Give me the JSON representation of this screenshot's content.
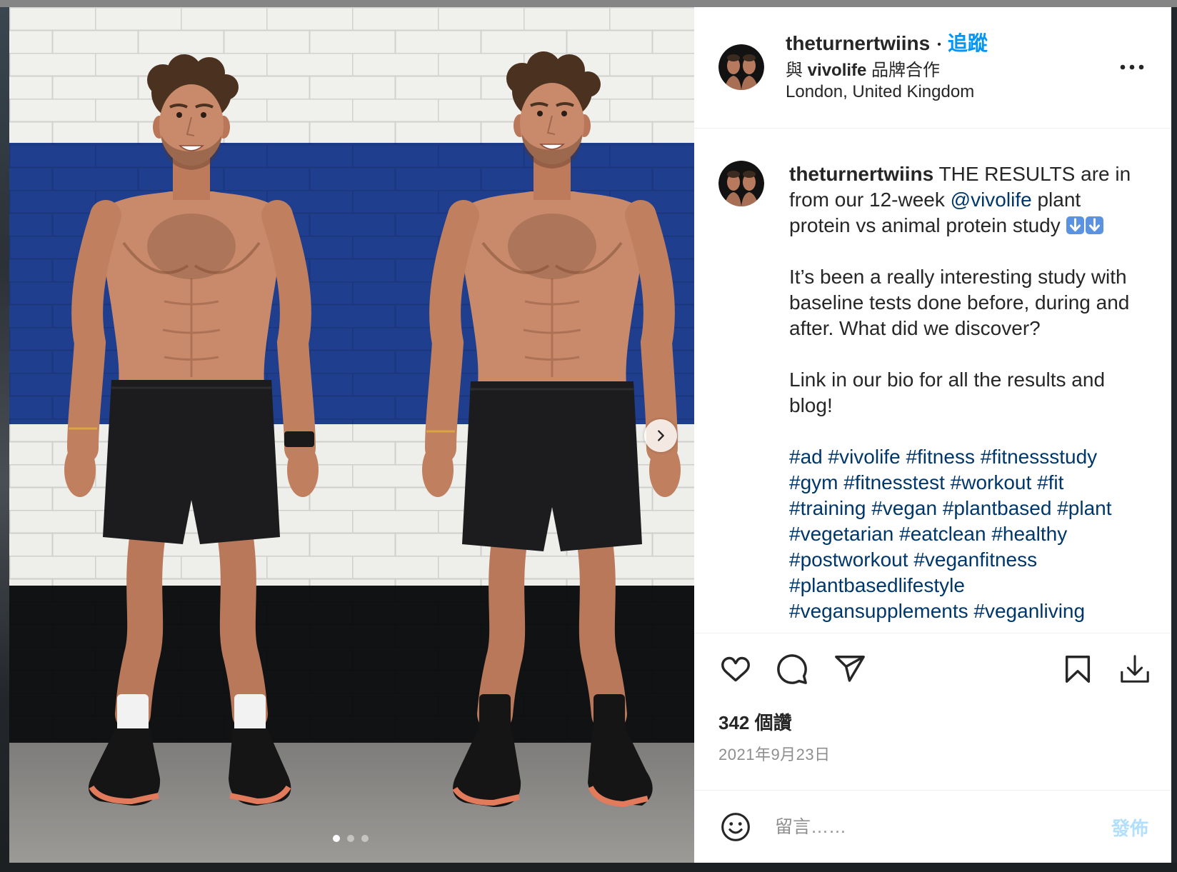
{
  "colors": {
    "text": "#262626",
    "link": "#00376b",
    "follow": "#0095f6",
    "secondary": "#8e8e8e",
    "post_disabled": "#b2dffc",
    "divider": "#efefef"
  },
  "post": {
    "header": {
      "avatar_icon": "profile-avatar",
      "username": "theturnertwiins",
      "separator": "•",
      "follow_label": "追蹤",
      "partnership_prefix": "與",
      "partnership_brand": "vivolife",
      "partnership_suffix": "品牌合作",
      "location": "London, United Kingdom",
      "more_icon": "more-options-icon"
    },
    "media": {
      "total": 3,
      "current_index": 1,
      "next_icon": "chevron-right-icon"
    },
    "caption": {
      "avatar_icon": "profile-avatar",
      "username": "theturnertwiins",
      "line1": "THE RESULTS are in",
      "line2_before": "from our 12-week",
      "mention": "@vivolife",
      "line2_after": "plant",
      "line3": "protein vs animal protein study",
      "line3_emoji": [
        "down-arrow-emoji-icon",
        "down-arrow-emoji-icon"
      ],
      "paragraph2": [
        "It’s been a really interesting study with",
        "baseline tests done before, during and",
        "after. What did we discover?"
      ],
      "paragraph3": [
        "Link in our bio for all the results and",
        "blog!"
      ],
      "hashtags": [
        [
          "#ad",
          "#vivolife",
          "#fitness",
          "#fitnessstudy"
        ],
        [
          "#gym",
          "#fitnesstest",
          "#workout",
          "#fit"
        ],
        [
          "#training",
          "#vegan",
          "#plantbased",
          "#plant"
        ],
        [
          "#vegetarian",
          "#eatclean",
          "#healthy"
        ],
        [
          "#postworkout",
          "#veganfitness"
        ],
        [
          "#plantbasedlifestyle"
        ],
        [
          "#vegansupplements",
          "#veganliving"
        ]
      ]
    },
    "actions": {
      "like_icon": "heart-icon",
      "comment_icon": "comment-icon",
      "share_icon": "paper-plane-icon",
      "save_icon": "bookmark-icon",
      "download_icon": "download-icon"
    },
    "likes": "342 個讚",
    "date": "2021年9月23日",
    "comment_box": {
      "emoji_icon": "smiley-icon",
      "placeholder": "留言……",
      "post_label": "發佈"
    }
  }
}
